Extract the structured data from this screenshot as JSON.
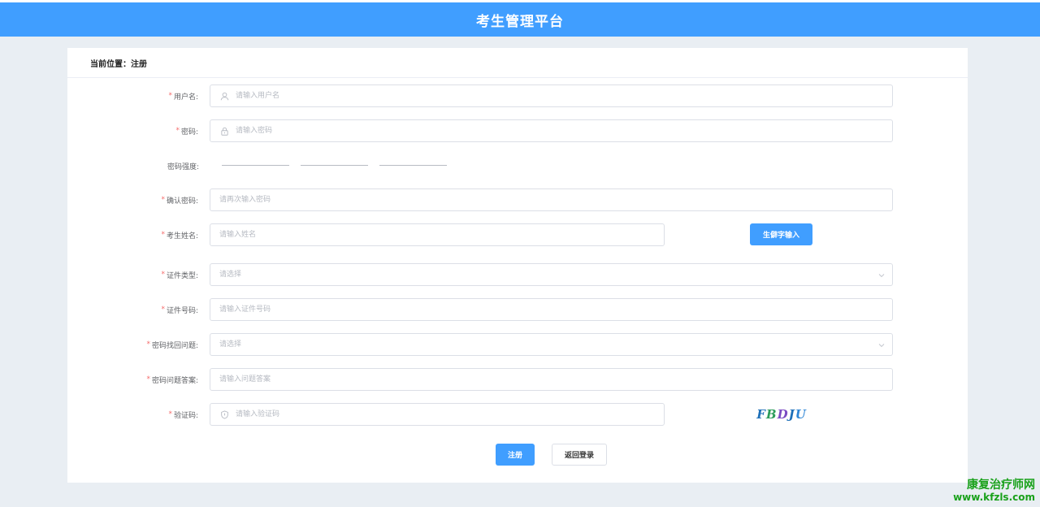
{
  "header": {
    "title": "考生管理平台"
  },
  "breadcrumb": {
    "text": "当前位置：注册"
  },
  "form": {
    "username": {
      "label": "用户名:",
      "placeholder": "请输入用户名",
      "required": "*"
    },
    "password": {
      "label": "密码:",
      "placeholder": "请输入密码",
      "required": "*"
    },
    "strength": {
      "label": "密码强度:"
    },
    "confirm": {
      "label": "确认密码:",
      "placeholder": "请再次输入密码",
      "required": "*"
    },
    "name": {
      "label": "考生姓名:",
      "placeholder": "请输入姓名",
      "required": "*",
      "button": "生僻字输入"
    },
    "id_type": {
      "label": "证件类型:",
      "placeholder": "请选择",
      "required": "*"
    },
    "id_number": {
      "label": "证件号码:",
      "placeholder": "请输入证件号码",
      "required": "*"
    },
    "question": {
      "label": "密码找回问题:",
      "placeholder": "请选择",
      "required": "*"
    },
    "answer": {
      "label": "密码问题答案:",
      "placeholder": "请输入问题答案",
      "required": "*"
    },
    "captcha": {
      "label": "验证码:",
      "placeholder": "请输入验证码",
      "required": "*",
      "chars": [
        "F",
        "B",
        "D",
        "J",
        "U"
      ]
    }
  },
  "actions": {
    "register": "注册",
    "back": "返回登录"
  },
  "watermark": {
    "line1": "康复治疗师网",
    "line2": "www.kfzls.com"
  },
  "colors": {
    "primary": "#409eff",
    "required": "#f56c6c",
    "background": "#e9eef3"
  }
}
